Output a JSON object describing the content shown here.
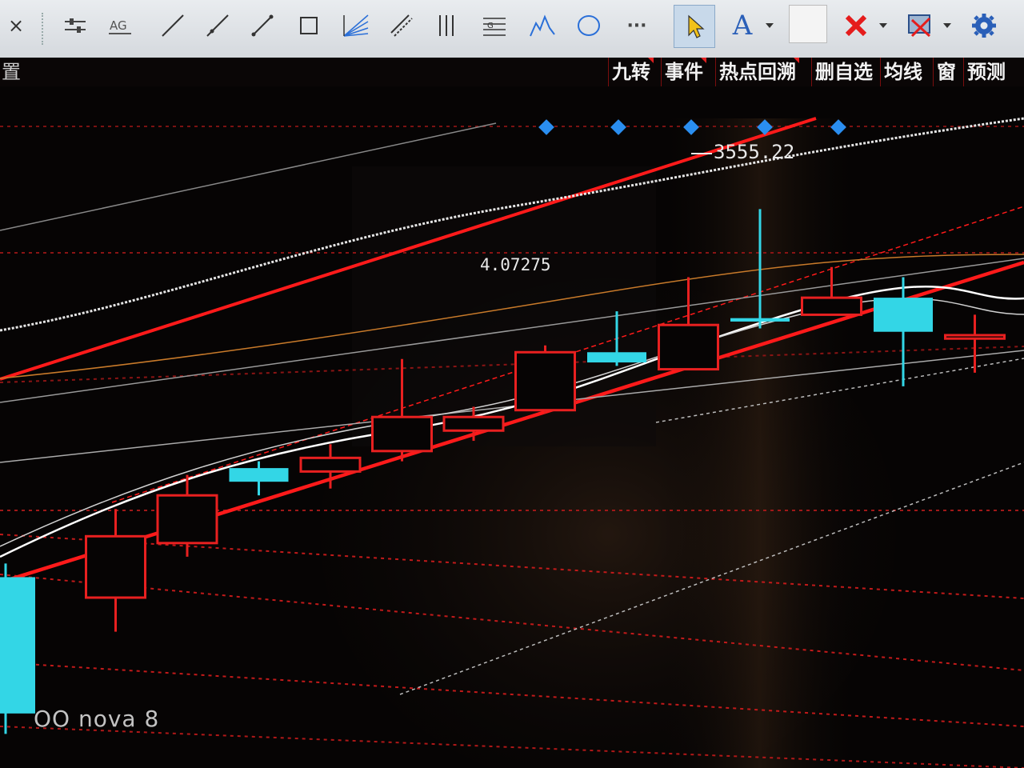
{
  "toolbar": {
    "close_label": "×",
    "tools": [
      "sliders-icon",
      "text-ag-icon",
      "line-icon",
      "ray-icon",
      "segment-icon",
      "rectangle-icon",
      "fan-icon",
      "channel-icon",
      "vertical-lines-icon",
      "fib-icon",
      "wave-icon",
      "circle-icon",
      "more-icon",
      "pointer-icon",
      "text-icon",
      "color-box-icon",
      "delete-icon",
      "screenshot-icon",
      "settings-icon"
    ],
    "text_tool_label": "A",
    "more_label": "···"
  },
  "menubar": {
    "items": [
      {
        "label": "九转",
        "flag": true
      },
      {
        "label": "事件",
        "flag": true
      },
      {
        "label": "热点回溯",
        "flag": true
      },
      {
        "label": "删自选",
        "flag": false
      },
      {
        "label": "均线",
        "flag": false
      },
      {
        "label": "窗",
        "flag": false
      },
      {
        "label": "预测",
        "flag": false
      }
    ],
    "left_fragment": "置"
  },
  "chart_icons": [
    "gear-icon",
    "pen-icon",
    "eye-icon",
    "box-icon",
    "hand-icon",
    "lock-icon",
    "plus-circle-icon"
  ],
  "chart_data": {
    "type": "candlestick",
    "annotations": {
      "high_label": "3555.22",
      "point_label": "4.07275"
    },
    "colors": {
      "up": "#e82020",
      "down": "#33d6e6",
      "ma1": "#ffffff",
      "ma2": "#d0d0d0",
      "ma3": "#c87a2a",
      "trend": "#ff1a1a"
    },
    "candles": [
      {
        "dir": "down",
        "o": 0.92,
        "c": 0.72,
        "h": 0.95,
        "l": 0.7
      },
      {
        "dir": "up",
        "o": 0.75,
        "c": 0.66,
        "h": 0.62,
        "l": 0.8
      },
      {
        "dir": "up",
        "o": 0.67,
        "c": 0.6,
        "h": 0.57,
        "l": 0.69
      },
      {
        "dir": "down",
        "o": 0.58,
        "c": 0.56,
        "h": 0.55,
        "l": 0.6
      },
      {
        "dir": "up",
        "o": 0.565,
        "c": 0.545,
        "h": 0.525,
        "l": 0.59
      },
      {
        "dir": "up",
        "o": 0.535,
        "c": 0.485,
        "h": 0.4,
        "l": 0.55
      },
      {
        "dir": "up",
        "o": 0.505,
        "c": 0.485,
        "h": 0.47,
        "l": 0.52
      },
      {
        "dir": "up",
        "o": 0.475,
        "c": 0.39,
        "h": 0.38,
        "l": 0.48
      },
      {
        "dir": "down",
        "o": 0.39,
        "c": 0.405,
        "h": 0.33,
        "l": 0.41
      },
      {
        "dir": "up",
        "o": 0.415,
        "c": 0.35,
        "h": 0.28,
        "l": 0.415
      },
      {
        "dir": "down",
        "o": 0.34,
        "c": 0.345,
        "h": 0.18,
        "l": 0.355
      },
      {
        "dir": "up",
        "o": 0.335,
        "c": 0.31,
        "h": 0.265,
        "l": 0.335
      },
      {
        "dir": "down",
        "o": 0.31,
        "c": 0.36,
        "h": 0.28,
        "l": 0.44
      },
      {
        "dir": "up",
        "o": 0.37,
        "c": 0.365,
        "h": 0.335,
        "l": 0.42
      }
    ]
  },
  "watermark": "OO nova 8"
}
